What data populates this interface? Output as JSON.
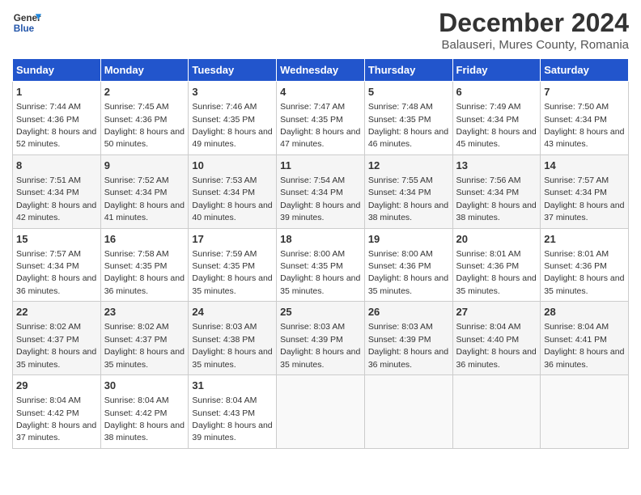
{
  "header": {
    "logo_line1": "General",
    "logo_line2": "Blue",
    "month": "December 2024",
    "location": "Balauseri, Mures County, Romania"
  },
  "weekdays": [
    "Sunday",
    "Monday",
    "Tuesday",
    "Wednesday",
    "Thursday",
    "Friday",
    "Saturday"
  ],
  "weeks": [
    [
      {
        "day": "1",
        "sunrise": "7:44 AM",
        "sunset": "4:36 PM",
        "daylight": "8 hours and 52 minutes."
      },
      {
        "day": "2",
        "sunrise": "7:45 AM",
        "sunset": "4:36 PM",
        "daylight": "8 hours and 50 minutes."
      },
      {
        "day": "3",
        "sunrise": "7:46 AM",
        "sunset": "4:35 PM",
        "daylight": "8 hours and 49 minutes."
      },
      {
        "day": "4",
        "sunrise": "7:47 AM",
        "sunset": "4:35 PM",
        "daylight": "8 hours and 47 minutes."
      },
      {
        "day": "5",
        "sunrise": "7:48 AM",
        "sunset": "4:35 PM",
        "daylight": "8 hours and 46 minutes."
      },
      {
        "day": "6",
        "sunrise": "7:49 AM",
        "sunset": "4:34 PM",
        "daylight": "8 hours and 45 minutes."
      },
      {
        "day": "7",
        "sunrise": "7:50 AM",
        "sunset": "4:34 PM",
        "daylight": "8 hours and 43 minutes."
      }
    ],
    [
      {
        "day": "8",
        "sunrise": "7:51 AM",
        "sunset": "4:34 PM",
        "daylight": "8 hours and 42 minutes."
      },
      {
        "day": "9",
        "sunrise": "7:52 AM",
        "sunset": "4:34 PM",
        "daylight": "8 hours and 41 minutes."
      },
      {
        "day": "10",
        "sunrise": "7:53 AM",
        "sunset": "4:34 PM",
        "daylight": "8 hours and 40 minutes."
      },
      {
        "day": "11",
        "sunrise": "7:54 AM",
        "sunset": "4:34 PM",
        "daylight": "8 hours and 39 minutes."
      },
      {
        "day": "12",
        "sunrise": "7:55 AM",
        "sunset": "4:34 PM",
        "daylight": "8 hours and 38 minutes."
      },
      {
        "day": "13",
        "sunrise": "7:56 AM",
        "sunset": "4:34 PM",
        "daylight": "8 hours and 38 minutes."
      },
      {
        "day": "14",
        "sunrise": "7:57 AM",
        "sunset": "4:34 PM",
        "daylight": "8 hours and 37 minutes."
      }
    ],
    [
      {
        "day": "15",
        "sunrise": "7:57 AM",
        "sunset": "4:34 PM",
        "daylight": "8 hours and 36 minutes."
      },
      {
        "day": "16",
        "sunrise": "7:58 AM",
        "sunset": "4:35 PM",
        "daylight": "8 hours and 36 minutes."
      },
      {
        "day": "17",
        "sunrise": "7:59 AM",
        "sunset": "4:35 PM",
        "daylight": "8 hours and 35 minutes."
      },
      {
        "day": "18",
        "sunrise": "8:00 AM",
        "sunset": "4:35 PM",
        "daylight": "8 hours and 35 minutes."
      },
      {
        "day": "19",
        "sunrise": "8:00 AM",
        "sunset": "4:36 PM",
        "daylight": "8 hours and 35 minutes."
      },
      {
        "day": "20",
        "sunrise": "8:01 AM",
        "sunset": "4:36 PM",
        "daylight": "8 hours and 35 minutes."
      },
      {
        "day": "21",
        "sunrise": "8:01 AM",
        "sunset": "4:36 PM",
        "daylight": "8 hours and 35 minutes."
      }
    ],
    [
      {
        "day": "22",
        "sunrise": "8:02 AM",
        "sunset": "4:37 PM",
        "daylight": "8 hours and 35 minutes."
      },
      {
        "day": "23",
        "sunrise": "8:02 AM",
        "sunset": "4:37 PM",
        "daylight": "8 hours and 35 minutes."
      },
      {
        "day": "24",
        "sunrise": "8:03 AM",
        "sunset": "4:38 PM",
        "daylight": "8 hours and 35 minutes."
      },
      {
        "day": "25",
        "sunrise": "8:03 AM",
        "sunset": "4:39 PM",
        "daylight": "8 hours and 35 minutes."
      },
      {
        "day": "26",
        "sunrise": "8:03 AM",
        "sunset": "4:39 PM",
        "daylight": "8 hours and 36 minutes."
      },
      {
        "day": "27",
        "sunrise": "8:04 AM",
        "sunset": "4:40 PM",
        "daylight": "8 hours and 36 minutes."
      },
      {
        "day": "28",
        "sunrise": "8:04 AM",
        "sunset": "4:41 PM",
        "daylight": "8 hours and 36 minutes."
      }
    ],
    [
      {
        "day": "29",
        "sunrise": "8:04 AM",
        "sunset": "4:42 PM",
        "daylight": "8 hours and 37 minutes."
      },
      {
        "day": "30",
        "sunrise": "8:04 AM",
        "sunset": "4:42 PM",
        "daylight": "8 hours and 38 minutes."
      },
      {
        "day": "31",
        "sunrise": "8:04 AM",
        "sunset": "4:43 PM",
        "daylight": "8 hours and 39 minutes."
      },
      null,
      null,
      null,
      null
    ]
  ]
}
